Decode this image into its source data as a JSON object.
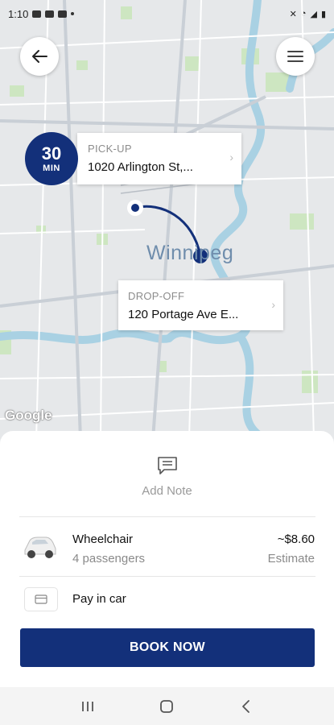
{
  "status_bar": {
    "time": "1:10"
  },
  "map": {
    "city_label": "Winnipeg",
    "provider": "Google",
    "eta": {
      "value": "30",
      "unit": "MIN"
    },
    "pickup": {
      "label": "PICK-UP",
      "address": "1020 Arlington St,..."
    },
    "dropoff": {
      "label": "DROP-OFF",
      "address": "120 Portage Ave E..."
    },
    "route_color": "#13307a"
  },
  "sheet": {
    "note_label": "Add Note",
    "ride": {
      "name": "Wheelchair",
      "passengers": "4 passengers",
      "price": "~$8.60",
      "price_note": "Estimate"
    },
    "payment": {
      "label": "Pay in car"
    },
    "book_button": "BOOK NOW"
  },
  "icons": [
    "back-arrow-icon",
    "menu-icon",
    "note-icon",
    "car-icon",
    "card-icon",
    "recents-icon",
    "home-icon",
    "back-icon"
  ]
}
